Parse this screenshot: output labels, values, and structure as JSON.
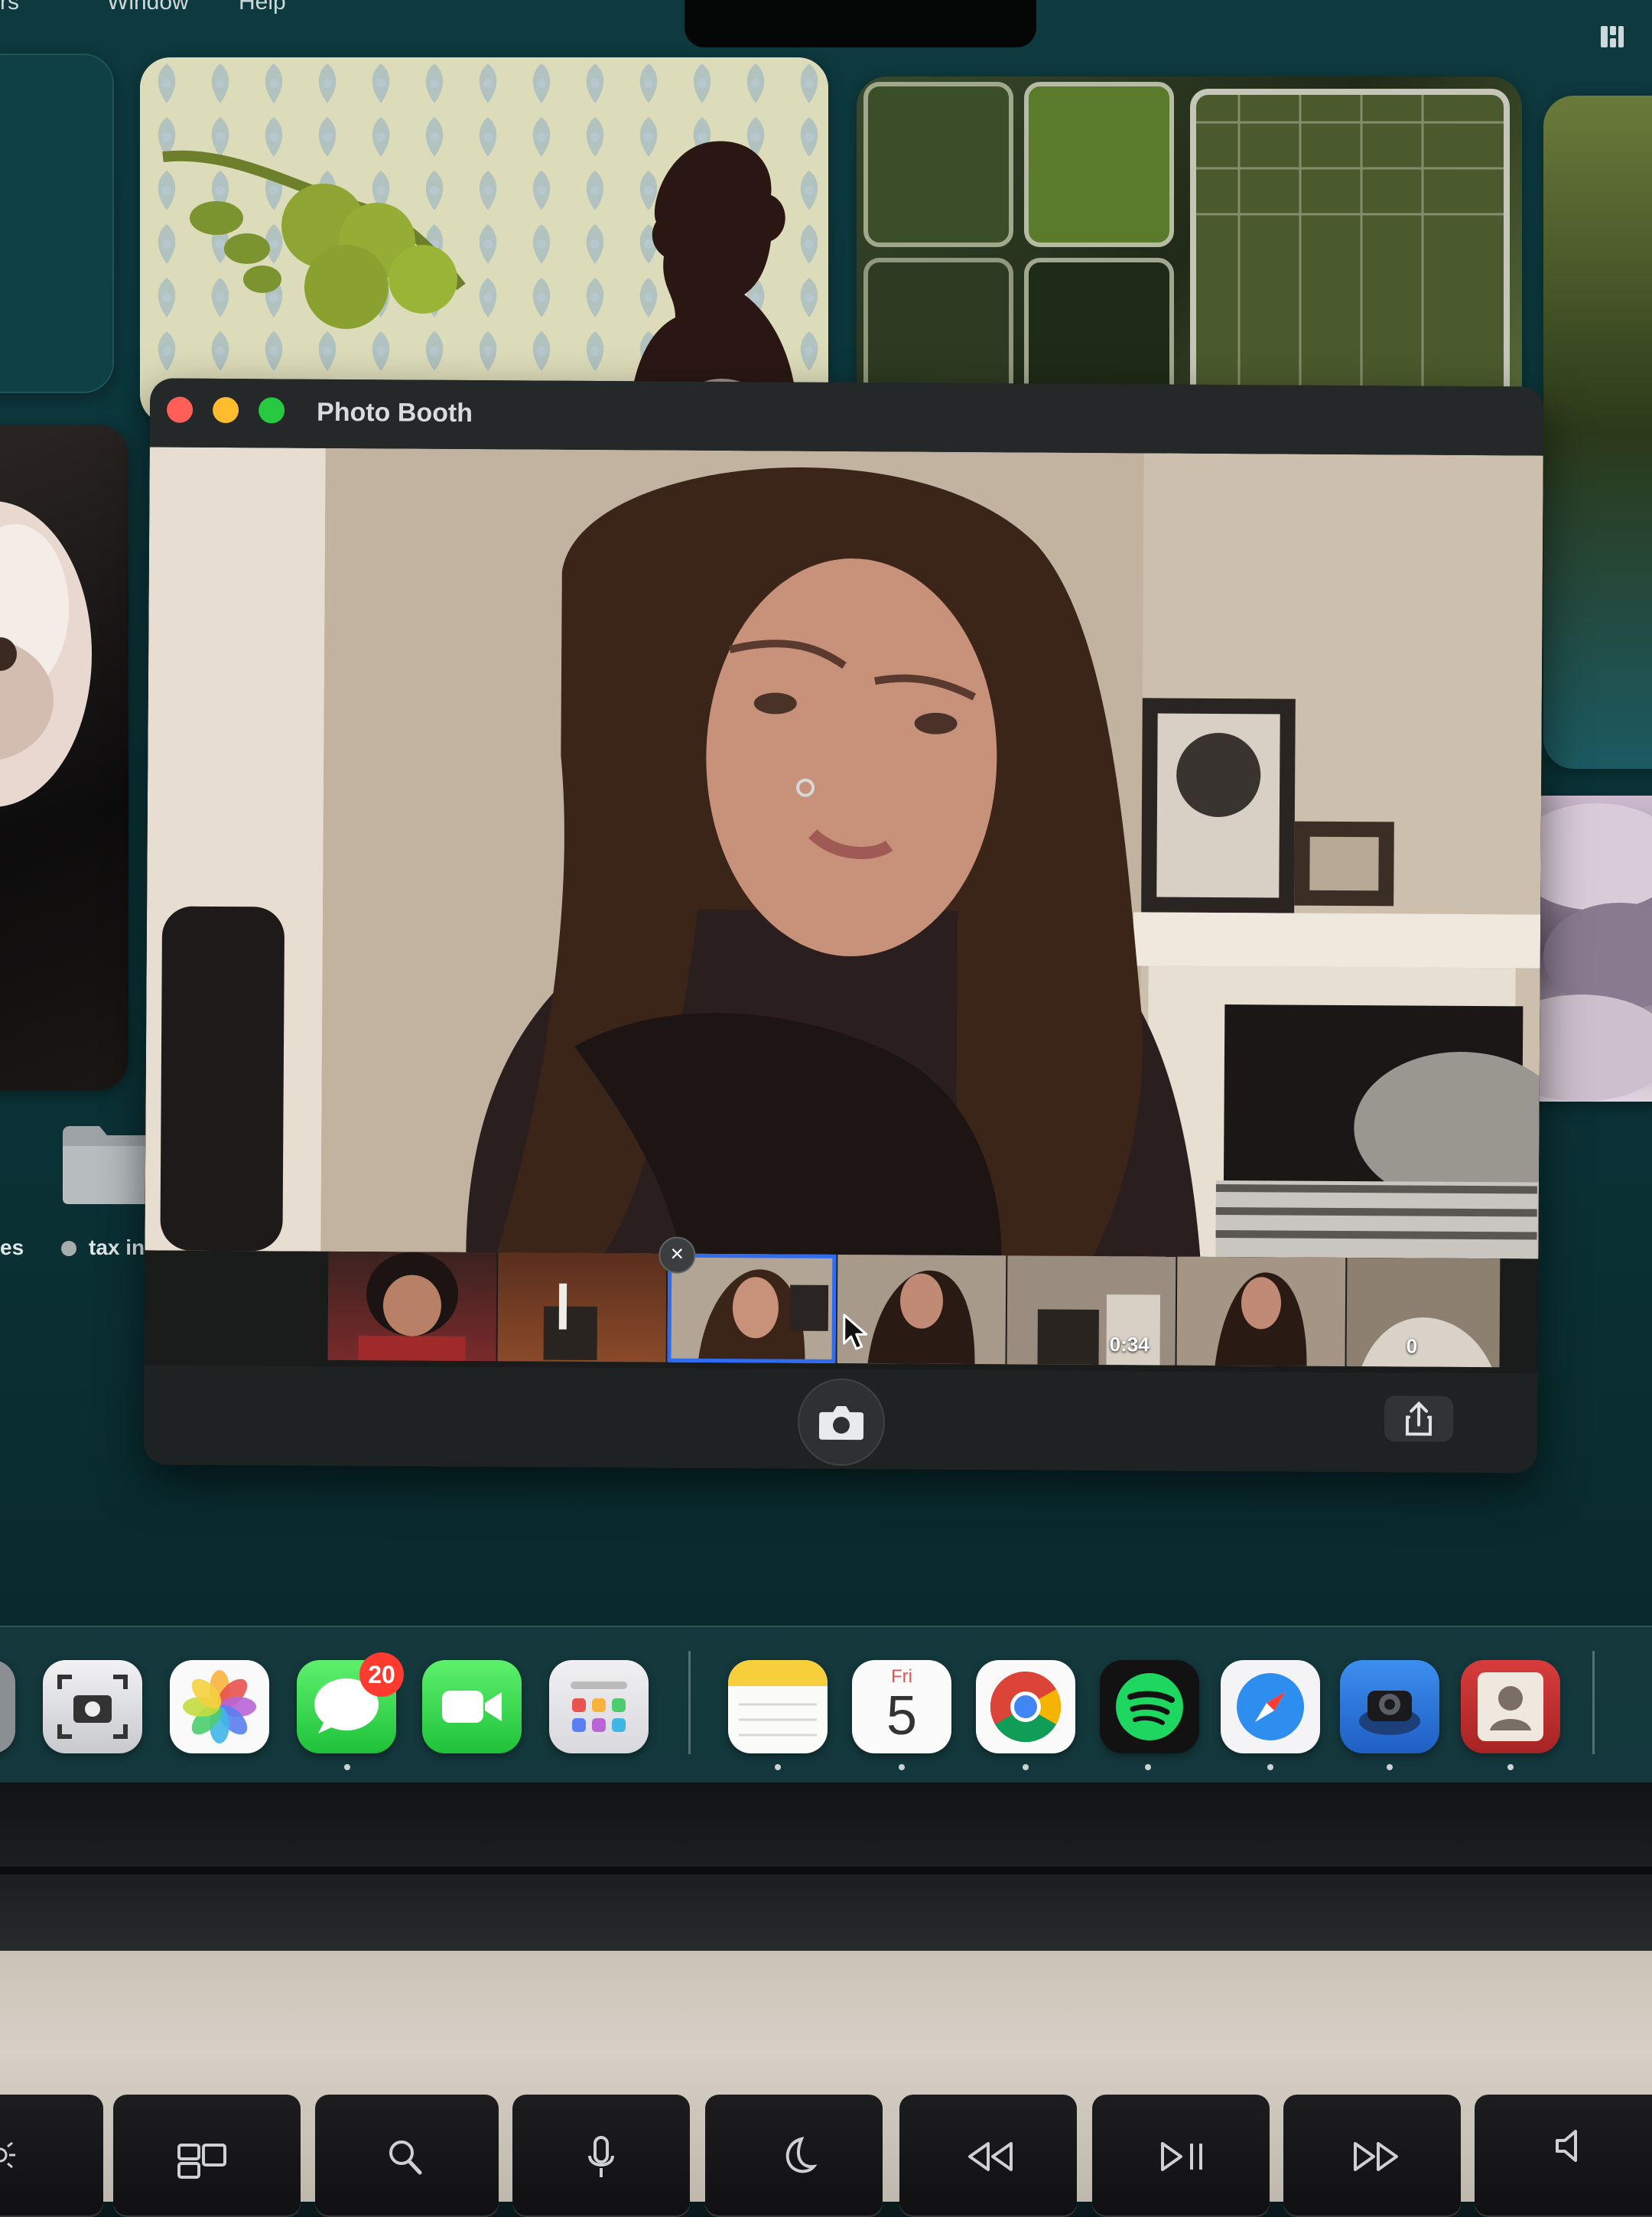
{
  "menubar": {
    "items": [
      "rs",
      "Window",
      "Help"
    ]
  },
  "desktop": {
    "labels": {
      "left_fragment": "es",
      "file_fragment": "tax in"
    }
  },
  "window": {
    "title": "Photo Booth",
    "filmstrip": {
      "remove_glyph": "×",
      "time_label": "0:34",
      "time_fragment": "0"
    }
  },
  "dock": {
    "apps": [
      {
        "name": "Screenshot",
        "icon": "screenshot-icon"
      },
      {
        "name": "Photos",
        "icon": "photos-icon"
      },
      {
        "name": "Messages",
        "icon": "messages-icon",
        "badge": "20"
      },
      {
        "name": "FaceTime",
        "icon": "facetime-icon"
      },
      {
        "name": "Launchpad",
        "icon": "launchpad-icon"
      },
      {
        "name": "Notes",
        "icon": "notes-icon"
      },
      {
        "name": "Calendar",
        "icon": "calendar-icon",
        "day": "Fri",
        "date": "5"
      },
      {
        "name": "Chrome",
        "icon": "chrome-icon"
      },
      {
        "name": "Spotify",
        "icon": "spotify-icon"
      },
      {
        "name": "Safari",
        "icon": "safari-icon"
      },
      {
        "name": "Photo Booth",
        "icon": "photobooth-icon"
      },
      {
        "name": "Contacts",
        "icon": "contacts-icon"
      }
    ]
  },
  "keyboard": {
    "icons": [
      "brightness-icon",
      "mission-control-icon",
      "search-icon",
      "dictation-icon",
      "focus-moon-icon",
      "rewind-icon",
      "play-pause-icon",
      "fast-forward-icon",
      "volume-icon"
    ]
  },
  "colors": {
    "desktop": "#0d3a3f",
    "window": "#1f2222",
    "selection": "#2f6cf2",
    "badge": "#ff3b30"
  }
}
